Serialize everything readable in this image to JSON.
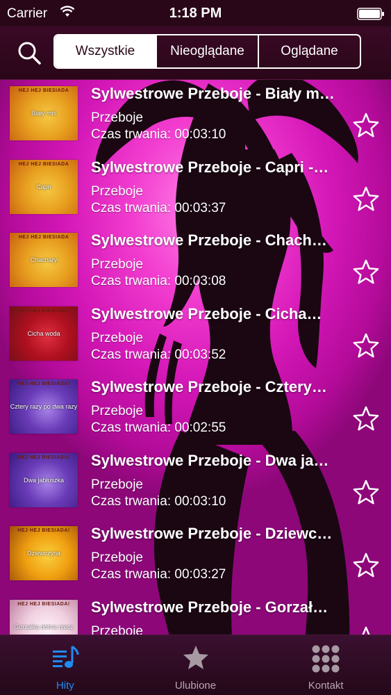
{
  "status_bar": {
    "carrier": "Carrier",
    "time": "1:18 PM",
    "wifi_icon": "wifi-icon",
    "battery_icon": "battery-icon"
  },
  "nav": {
    "search_icon": "search-icon",
    "segments": [
      {
        "label": "Wszystkie",
        "selected": true
      },
      {
        "label": "Nieoglądane",
        "selected": false
      },
      {
        "label": "Oglądane",
        "selected": false
      }
    ]
  },
  "list": {
    "items": [
      {
        "title": "Sylwestrowe Przeboje - Biały m…",
        "category": "Przeboje",
        "duration": "Czas trwania: 00:03:10",
        "thumb_label": "Biały miś",
        "thumb_header": "HEJ HEJ BIESIADA",
        "thumb_colors": [
          "#e8a020",
          "#f5c842",
          "#c86010"
        ],
        "favorite": false
      },
      {
        "title": "Sylwestrowe Przeboje - Capri -…",
        "category": "Przeboje",
        "duration": "Czas trwania: 00:03:37",
        "thumb_label": "Capri",
        "thumb_header": "HEJ HEJ BIESIADA",
        "thumb_colors": [
          "#e8a020",
          "#f5c842",
          "#c86010"
        ],
        "favorite": false
      },
      {
        "title": "Sylwestrowe Przeboje - Chach…",
        "category": "Przeboje",
        "duration": "Czas trwania: 00:03:08",
        "thumb_label": "Chachary",
        "thumb_header": "HEJ HEJ BIESIADA",
        "thumb_colors": [
          "#e8a020",
          "#f5c842",
          "#c86010"
        ],
        "favorite": false
      },
      {
        "title": "Sylwestrowe Przeboje - Cicha…",
        "category": "Przeboje",
        "duration": "Czas trwania: 00:03:52",
        "thumb_label": "Cicha woda",
        "thumb_header": "HEJ HEJ BIESIADA!",
        "thumb_colors": [
          "#b01020",
          "#e03040",
          "#701018"
        ],
        "favorite": false
      },
      {
        "title": "Sylwestrowe Przeboje - Cztery…",
        "category": "Przeboje",
        "duration": "Czas trwania: 00:02:55",
        "thumb_label": "Cztery razy po dwa razy",
        "thumb_header": "HEJ HEJ BIESIADA!",
        "thumb_colors": [
          "#6a3cb8",
          "#a884e8",
          "#3a1a80"
        ],
        "favorite": false
      },
      {
        "title": "Sylwestrowe Przeboje - Dwa ja…",
        "category": "Przeboje",
        "duration": "Czas trwania: 00:03:10",
        "thumb_label": "Dwa jabłuszka",
        "thumb_header": "HEJ HEJ BIESIADA!",
        "thumb_colors": [
          "#6a3cb8",
          "#a884e8",
          "#3a1a80"
        ],
        "favorite": false
      },
      {
        "title": "Sylwestrowe Przeboje - Dziewc…",
        "category": "Przeboje",
        "duration": "Czas trwania: 00:03:27",
        "thumb_label": "Dziewczyna",
        "thumb_header": "HEJ HEJ BIESIADA!",
        "thumb_colors": [
          "#f0a010",
          "#f8d040",
          "#a05008"
        ],
        "favorite": false
      },
      {
        "title": "Sylwestrowe Przeboje - Gorzał…",
        "category": "Przeboje",
        "duration": "",
        "thumb_label": "Gorzałka dobra rzecz",
        "thumb_header": "HEJ HEJ BIESIADA!",
        "thumb_colors": [
          "#f0d0e0",
          "#fff0f8",
          "#c080a0"
        ],
        "favorite": false
      }
    ]
  },
  "tabbar": {
    "tabs": [
      {
        "label": "Hity",
        "icon": "music-list-icon",
        "active": true
      },
      {
        "label": "Ulubione",
        "icon": "star-icon",
        "active": false
      },
      {
        "label": "Kontakt",
        "icon": "keypad-icon",
        "active": false
      }
    ],
    "active_color": "#1f8cf5"
  }
}
